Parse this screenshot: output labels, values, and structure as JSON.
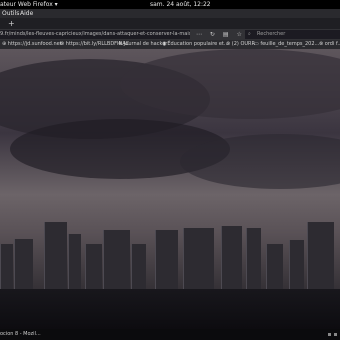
{
  "top_bar": {
    "app_name": "ateur Web Firefox ▾",
    "clock": "sam. 24 août, 12:22"
  },
  "menu": {
    "items": [
      "Outils",
      "Aide"
    ]
  },
  "tabs": {
    "new_tab_label": "+"
  },
  "navbar": {
    "url": "9.fr/minds/les-fleuves-capricieux/images/dans-attaquer-et-conserver-la-maison-bruissante-25-08-20...",
    "icons": [
      "page-actions-icon",
      "refresh-icon",
      "reader-icon",
      "bookmark-star-icon"
    ],
    "search_placeholder": "Rechercher"
  },
  "bookmarks": [
    "⊕ https://jd.sunfood.net",
    "⊗ https://bit.ly/RLLBDFINAC",
    "⊗ Journal de hacker",
    "▮ Éducation populaire et...",
    "⊗ (2) OURR",
    "▭ feuille_de_temps_202...",
    "⊗ ordi f..."
  ],
  "taskbar": {
    "active_task": "ocion 8 - Mozil..."
  },
  "colors": {
    "accent": "#e0356e",
    "chrome_dark": "#1f1f23",
    "sky": "#5e565c"
  }
}
